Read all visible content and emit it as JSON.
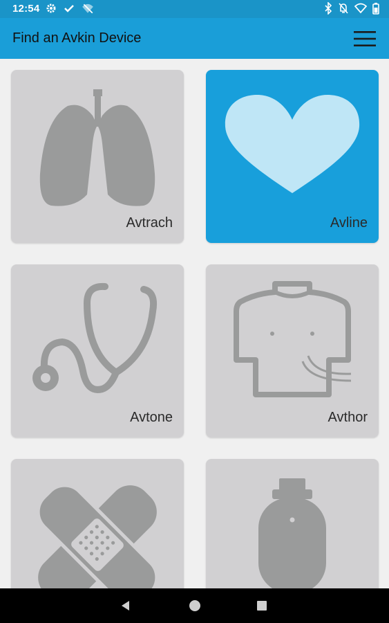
{
  "status_bar": {
    "time": "12:54",
    "left_icons": [
      "gear-icon",
      "check-icon",
      "wifi-off-icon"
    ],
    "right_icons": [
      "bluetooth-icon",
      "mute-icon",
      "wifi-icon",
      "battery-icon"
    ]
  },
  "app_bar": {
    "title": "Find an Avkin Device",
    "menu_icon": "hamburger-menu-icon"
  },
  "devices": [
    {
      "label": "Avtrach",
      "icon": "lungs-icon",
      "selected": false
    },
    {
      "label": "Avline",
      "icon": "heart-icon",
      "selected": true
    },
    {
      "label": "Avtone",
      "icon": "stethoscope-icon",
      "selected": false
    },
    {
      "label": "Avthor",
      "icon": "torso-icon",
      "selected": false
    },
    {
      "label": "",
      "icon": "bandage-icon",
      "selected": false
    },
    {
      "label": "",
      "icon": "wristband-icon",
      "selected": false
    }
  ],
  "colors": {
    "status_bar": "#1a94c8",
    "app_bar": "#1a9ed8",
    "tile": "#d1d0d2",
    "tile_selected": "#189fdb",
    "icon_gray": "#9a9b9b",
    "heart": "#bfe6f6"
  },
  "nav_bar": {
    "buttons": [
      "back-icon",
      "home-icon",
      "recents-icon"
    ]
  }
}
